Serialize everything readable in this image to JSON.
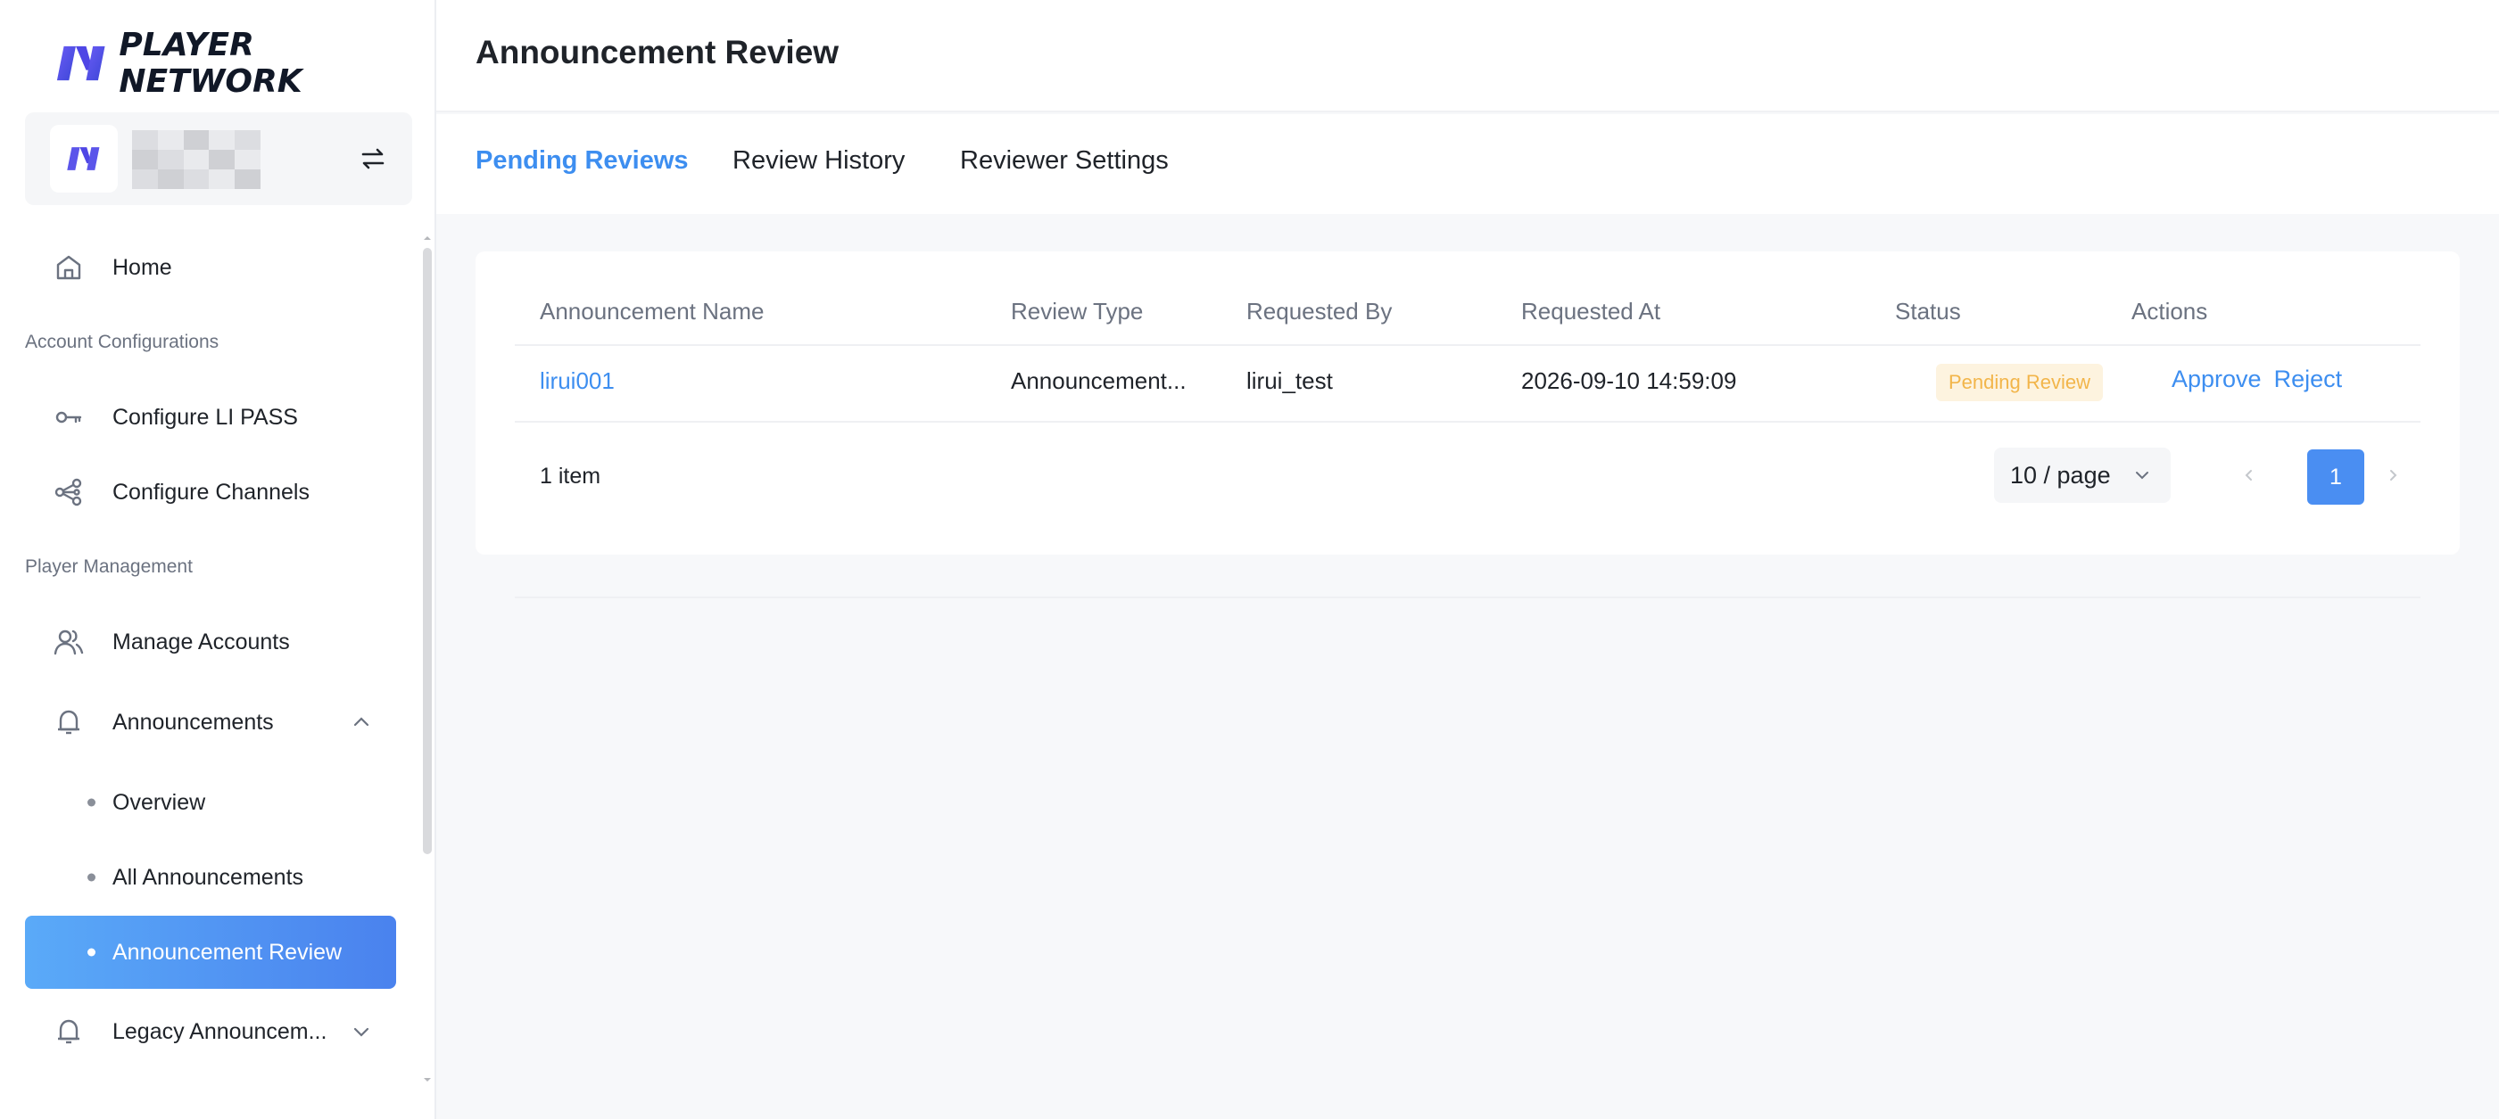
{
  "brand": {
    "name": "PLAYER NETWORK",
    "color": "#4f46e5"
  },
  "account": {
    "switch_icon": "swap-icon"
  },
  "sidebar": {
    "home": "Home",
    "section_account": "Account Configurations",
    "configure_li_pass": "Configure LI PASS",
    "configure_channels": "Configure Channels",
    "section_player": "Player Management",
    "manage_accounts": "Manage Accounts",
    "announcements": "Announcements",
    "overview": "Overview",
    "all_announcements": "All Announcements",
    "announcement_review": "Announcement Review",
    "legacy_announcements": "Legacy Announcem..."
  },
  "header": {
    "title": "Announcement Review"
  },
  "tabs": [
    "Pending Reviews",
    "Review History",
    "Reviewer Settings"
  ],
  "table": {
    "columns": [
      "Announcement Name",
      "Review Type",
      "Requested By",
      "Requested At",
      "Status",
      "Actions"
    ],
    "rows": [
      {
        "name": "lirui001",
        "review_type": "Announcement...",
        "requested_by": "lirui_test",
        "requested_at": "2026-09-10 14:59:09",
        "status": "Pending Review",
        "approve": "Approve",
        "reject": "Reject"
      }
    ]
  },
  "pagination": {
    "total": "1 item",
    "page_size": "10 / page",
    "current_page": "1"
  },
  "colors": {
    "accent": "#3d8ef0",
    "active_nav_from": "#5aaaf8",
    "active_nav_to": "#4a82ee",
    "pending_badge_bg": "#fdf3df",
    "pending_badge_text": "#f2b54a"
  }
}
